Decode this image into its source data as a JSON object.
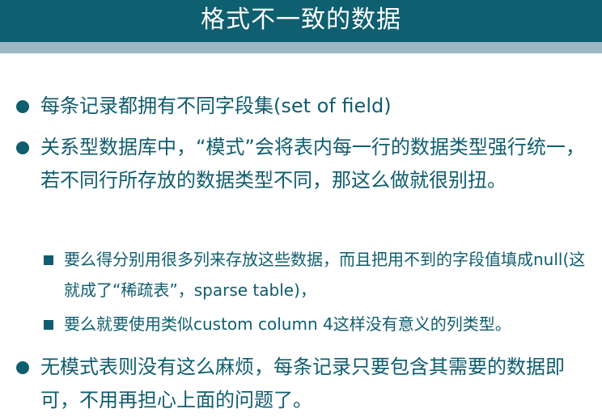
{
  "slide": {
    "title": "格式不一致的数据",
    "bullets": [
      {
        "level": 1,
        "text": "每条记录都拥有不同字段集(set of field)"
      },
      {
        "level": 1,
        "text": "关系型数据库中，“模式”会将表内每一行的数据类型强行统一，若不同行所存放的数据类型不同，那这么做就很别扭。"
      },
      {
        "level": 2,
        "text": "要么得分别用很多列来存放这些数据，而且把用不到的字段值填成null(这就成了“稀疏表”，sparse table)，"
      },
      {
        "level": 2,
        "text": "要么就要使用类似custom column 4这样没有意义的列类型。"
      },
      {
        "level": 1,
        "text": "无模式表则没有这么麻烦，每条记录只要包含其需要的数据即可，不用再担心上面的问题了。"
      }
    ]
  },
  "colors": {
    "title_bar": "#0e5f70",
    "sub_band": "#9bb8c4",
    "text": "#0f5d6e",
    "title_text": "#ffffff"
  }
}
